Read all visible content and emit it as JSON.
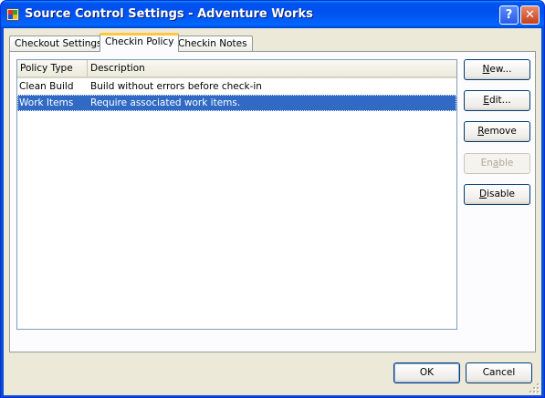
{
  "window": {
    "title": "Source Control Settings - Adventure Works",
    "help_label": "?",
    "close_label": "✕"
  },
  "tabs": [
    {
      "label": "Checkout Settings"
    },
    {
      "label": "Checkin Policy"
    },
    {
      "label": "Checkin Notes"
    }
  ],
  "active_tab": "Checkin Policy",
  "policy_list": {
    "columns": [
      "Policy Type",
      "Description"
    ],
    "rows": [
      {
        "type": "Clean Build",
        "description": "Build without errors before check-in",
        "selected": false
      },
      {
        "type": "Work Items",
        "description": "Require associated work items.",
        "selected": true
      }
    ]
  },
  "side_buttons": {
    "new": {
      "pre": "",
      "mnemonic": "N",
      "post": "ew..."
    },
    "edit": {
      "pre": "",
      "mnemonic": "E",
      "post": "dit..."
    },
    "remove": {
      "pre": "",
      "mnemonic": "R",
      "post": "emove"
    },
    "enable": {
      "pre": "En",
      "mnemonic": "a",
      "post": "ble",
      "disabled": true
    },
    "disable": {
      "pre": "",
      "mnemonic": "D",
      "post": "isable"
    }
  },
  "footer": {
    "ok_label": "OK",
    "cancel_label": "Cancel"
  }
}
